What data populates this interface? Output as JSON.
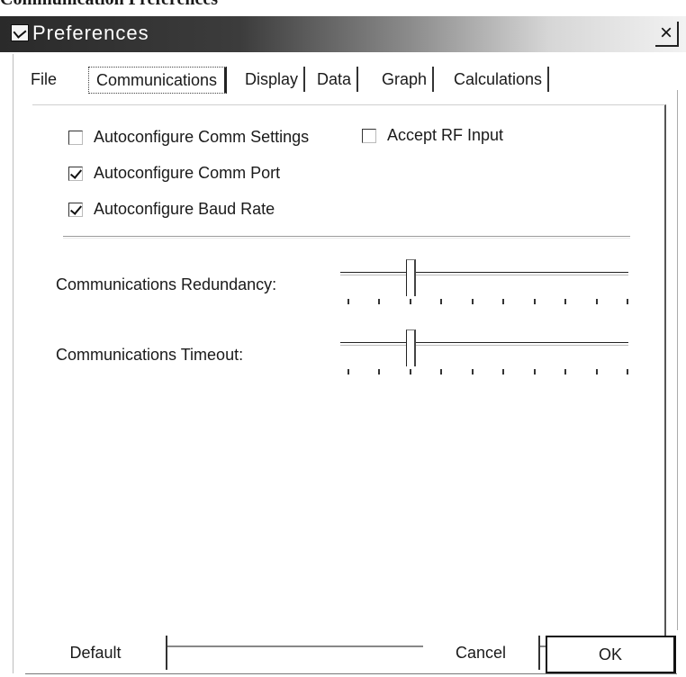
{
  "document_heading": "Communication Preferences",
  "window": {
    "title": "Preferences",
    "close_glyph": "×"
  },
  "tabs": [
    {
      "label": "File",
      "active": false
    },
    {
      "label": "Communications",
      "active": true
    },
    {
      "label": "Display",
      "active": false
    },
    {
      "label": "Data",
      "active": false
    },
    {
      "label": "Graph",
      "active": false
    },
    {
      "label": "Calculations",
      "active": false
    }
  ],
  "checkboxes": [
    {
      "label": "Autoconfigure Comm Settings",
      "checked": false
    },
    {
      "label": "Accept RF Input",
      "checked": false
    },
    {
      "label": "Autoconfigure Comm Port",
      "checked": true
    },
    {
      "label": "Autoconfigure Baud Rate",
      "checked": true
    }
  ],
  "sliders": [
    {
      "label": "Communications Redundancy:",
      "ticks": 10,
      "position": 2
    },
    {
      "label": "Communications Timeout:",
      "ticks": 10,
      "position": 2
    }
  ],
  "buttons": {
    "default": "Default",
    "cancel": "Cancel",
    "ok": "OK"
  },
  "icons": {
    "window_icon": "preferences-window-icon"
  }
}
